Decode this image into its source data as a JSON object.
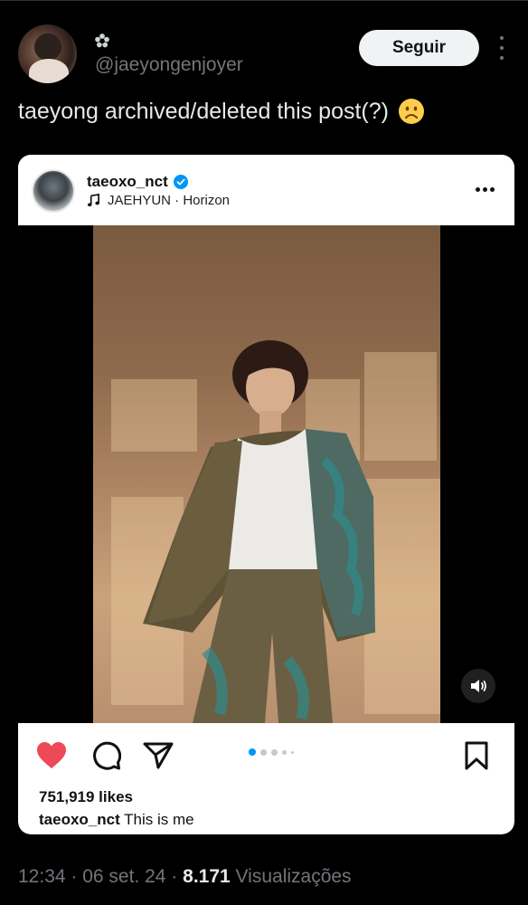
{
  "tweet": {
    "handle": "@jaeyongenjoyer",
    "follow_label": "Seguir",
    "text": "taeyong archived/deleted this post(?)",
    "emoji": "frowning-face-icon"
  },
  "instagram": {
    "username": "taeoxo_nct",
    "verified": true,
    "music": "JAEHYUN · Horizon",
    "likes": "751,919 likes",
    "caption_user": "taeoxo_nct",
    "caption_text": "This is me",
    "carousel": {
      "count": 5,
      "active": 1
    },
    "accent_color": "#ed4956",
    "dot_active_color": "#0095f6"
  },
  "footer": {
    "time": "12:34",
    "sep1": " · ",
    "date": "06 set. 24",
    "sep2": " · ",
    "views": "8.171",
    "views_label": " Visualizações"
  }
}
